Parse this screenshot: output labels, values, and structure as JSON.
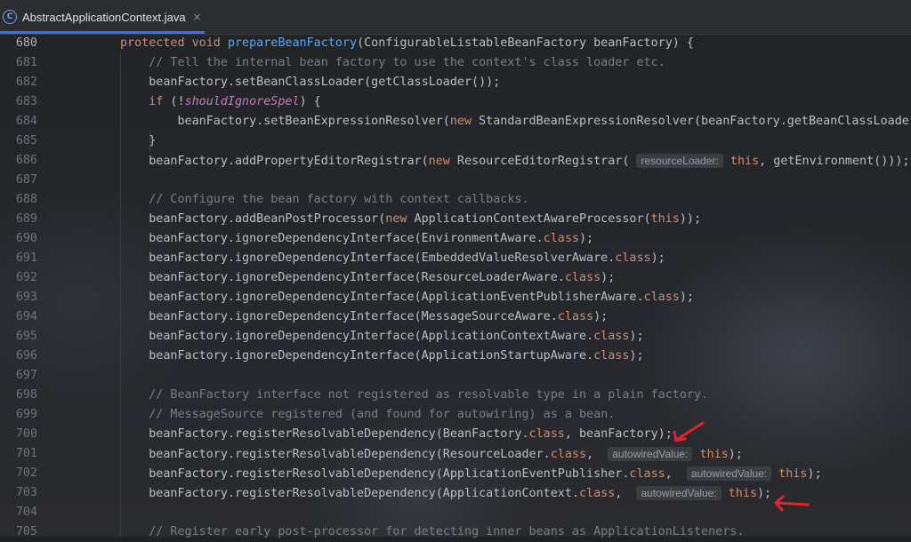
{
  "tab": {
    "title": "AbstractApplicationContext.java",
    "close": "×",
    "icon": "java-class-icon"
  },
  "lines": [
    {
      "no": "680",
      "code": "protected void prepareBeanFactory(ConfigurableListableBeanFactory beanFactory) {"
    },
    {
      "no": "681",
      "code": "    // Tell the internal bean factory to use the context's class loader etc."
    },
    {
      "no": "682",
      "code": "    beanFactory.setBeanClassLoader(getClassLoader());"
    },
    {
      "no": "683",
      "code": "    if (!shouldIgnoreSpel) {"
    },
    {
      "no": "684",
      "code": "        beanFactory.setBeanExpressionResolver(new StandardBeanExpressionResolver(beanFactory.getBeanClassLoader"
    },
    {
      "no": "685",
      "code": "    }"
    },
    {
      "no": "686",
      "code": "    beanFactory.addPropertyEditorRegistrar(new ResourceEditorRegistrar( resourceLoader: this, getEnvironment()));"
    },
    {
      "no": "687",
      "code": ""
    },
    {
      "no": "688",
      "code": "    // Configure the bean factory with context callbacks."
    },
    {
      "no": "689",
      "code": "    beanFactory.addBeanPostProcessor(new ApplicationContextAwareProcessor(this));"
    },
    {
      "no": "690",
      "code": "    beanFactory.ignoreDependencyInterface(EnvironmentAware.class);"
    },
    {
      "no": "691",
      "code": "    beanFactory.ignoreDependencyInterface(EmbeddedValueResolverAware.class);"
    },
    {
      "no": "692",
      "code": "    beanFactory.ignoreDependencyInterface(ResourceLoaderAware.class);"
    },
    {
      "no": "693",
      "code": "    beanFactory.ignoreDependencyInterface(ApplicationEventPublisherAware.class);"
    },
    {
      "no": "694",
      "code": "    beanFactory.ignoreDependencyInterface(MessageSourceAware.class);"
    },
    {
      "no": "695",
      "code": "    beanFactory.ignoreDependencyInterface(ApplicationContextAware.class);"
    },
    {
      "no": "696",
      "code": "    beanFactory.ignoreDependencyInterface(ApplicationStartupAware.class);"
    },
    {
      "no": "697",
      "code": ""
    },
    {
      "no": "698",
      "code": "    // BeanFactory interface not registered as resolvable type in a plain factory."
    },
    {
      "no": "699",
      "code": "    // MessageSource registered (and found for autowiring) as a bean."
    },
    {
      "no": "700",
      "code": "    beanFactory.registerResolvableDependency(BeanFactory.class, beanFactory);"
    },
    {
      "no": "701",
      "code": "    beanFactory.registerResolvableDependency(ResourceLoader.class,  autowiredValue: this);"
    },
    {
      "no": "702",
      "code": "    beanFactory.registerResolvableDependency(ApplicationEventPublisher.class,  autowiredValue: this);"
    },
    {
      "no": "703",
      "code": "    beanFactory.registerResolvableDependency(ApplicationContext.class,  autowiredValue: this);"
    },
    {
      "no": "704",
      "code": ""
    },
    {
      "no": "705",
      "code": "    // Register early post-processor for detecting inner beans as ApplicationListeners."
    }
  ],
  "colors": {
    "keyword": "#cf8e6d",
    "method": "#56a8f5",
    "comment": "#7a7e85",
    "annotation_arrow": "#e0242c",
    "tab_accent": "#3574f0"
  }
}
